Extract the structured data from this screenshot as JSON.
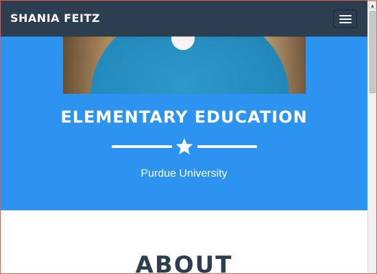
{
  "navbar": {
    "brand": "SHANIA FEITZ",
    "menu_icon": "hamburger-menu-icon"
  },
  "header": {
    "photo_alt": "profile-photo",
    "title": "ELEMENTARY EDUCATION",
    "divider_icon": "star-icon",
    "subtitle": "Purdue University",
    "background_color": "#2d93f0"
  },
  "about": {
    "heading": "ABOUT"
  },
  "scrollbar": {
    "up_arrow": "▲"
  },
  "colors": {
    "navbar": "#2c3e50",
    "accent": "#2d93f0",
    "text_dark": "#2c3e50"
  }
}
